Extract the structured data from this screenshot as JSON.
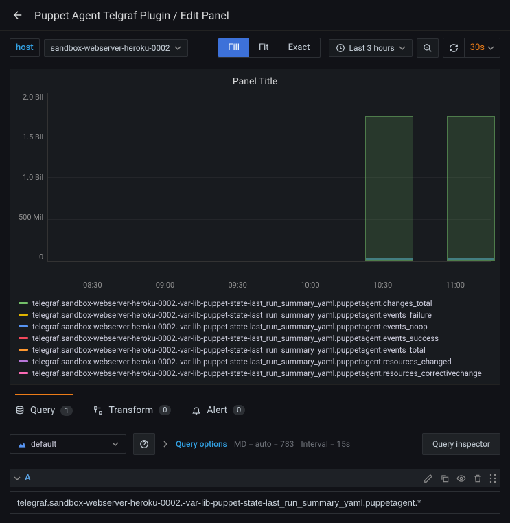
{
  "header": {
    "breadcrumb": "Puppet Agent Telgraf Plugin / Edit Panel"
  },
  "vars": {
    "host_label": "host",
    "host_value": "sandbox-webserver-heroku-0002"
  },
  "viewmode": {
    "fill": "Fill",
    "fit": "Fit",
    "exact": "Exact"
  },
  "timerange": {
    "label": "Last 3 hours",
    "refresh": "30s"
  },
  "chart": {
    "title": "Panel Title",
    "yticks": [
      "2.0 Bil",
      "1.5 Bil",
      "1.0 Bil",
      "500 Mil",
      "0"
    ],
    "xticks": [
      "08:30",
      "09:00",
      "09:30",
      "10:00",
      "10:30",
      "11:00"
    ]
  },
  "chart_data": {
    "type": "bar",
    "title": "Panel Title",
    "ylabel": "",
    "ylim": [
      0,
      2000000000
    ],
    "x": [
      "08:30",
      "09:00",
      "09:30",
      "10:00",
      "10:30",
      "11:00"
    ],
    "series": [
      {
        "name": "telegraf.sandbox-webserver-heroku-0002.-var-lib-puppet-state-last_run_summary_yaml.puppetagent.changes_total",
        "color": "#73bf69",
        "values": [
          null,
          null,
          null,
          null,
          1720000000,
          1720000000
        ]
      },
      {
        "name": "telegraf.sandbox-webserver-heroku-0002.-var-lib-puppet-state-last_run_summary_yaml.puppetagent.events_failure",
        "color": "#e0b400",
        "values": [
          null,
          null,
          null,
          null,
          0,
          0
        ]
      },
      {
        "name": "telegraf.sandbox-webserver-heroku-0002.-var-lib-puppet-state-last_run_summary_yaml.puppetagent.events_noop",
        "color": "#5794f2",
        "values": [
          null,
          null,
          null,
          null,
          0,
          0
        ]
      },
      {
        "name": "telegraf.sandbox-webserver-heroku-0002.-var-lib-puppet-state-last_run_summary_yaml.puppetagent.events_success",
        "color": "#f2495c",
        "values": [
          null,
          null,
          null,
          null,
          0,
          0
        ]
      },
      {
        "name": "telegraf.sandbox-webserver-heroku-0002.-var-lib-puppet-state-last_run_summary_yaml.puppetagent.events_total",
        "color": "#ff9830",
        "values": [
          null,
          null,
          null,
          null,
          0,
          0
        ]
      },
      {
        "name": "telegraf.sandbox-webserver-heroku-0002.-var-lib-puppet-state-last_run_summary_yaml.puppetagent.resources_changed",
        "color": "#b877d9",
        "values": [
          null,
          null,
          null,
          null,
          0,
          0
        ]
      },
      {
        "name": "telegraf.sandbox-webserver-heroku-0002.-var-lib-puppet-state-last_run_summary_yaml.puppetagent.resources_correctivechange",
        "color": "#fa6ab4",
        "values": [
          null,
          null,
          null,
          null,
          0,
          0
        ]
      }
    ]
  },
  "legend": [
    {
      "color": "#73bf69",
      "label": "telegraf.sandbox-webserver-heroku-0002.-var-lib-puppet-state-last_run_summary_yaml.puppetagent.changes_total"
    },
    {
      "color": "#e0b400",
      "label": "telegraf.sandbox-webserver-heroku-0002.-var-lib-puppet-state-last_run_summary_yaml.puppetagent.events_failure"
    },
    {
      "color": "#5794f2",
      "label": "telegraf.sandbox-webserver-heroku-0002.-var-lib-puppet-state-last_run_summary_yaml.puppetagent.events_noop"
    },
    {
      "color": "#f2495c",
      "label": "telegraf.sandbox-webserver-heroku-0002.-var-lib-puppet-state-last_run_summary_yaml.puppetagent.events_success"
    },
    {
      "color": "#ff9830",
      "label": "telegraf.sandbox-webserver-heroku-0002.-var-lib-puppet-state-last_run_summary_yaml.puppetagent.events_total"
    },
    {
      "color": "#b877d9",
      "label": "telegraf.sandbox-webserver-heroku-0002.-var-lib-puppet-state-last_run_summary_yaml.puppetagent.resources_changed"
    },
    {
      "color": "#fa6ab4",
      "label": "telegraf.sandbox-webserver-heroku-0002.-var-lib-puppet-state-last_run_summary_yaml.puppetagent.resources_correctivechange"
    }
  ],
  "tabs": {
    "query": "Query",
    "query_count": "1",
    "transform": "Transform",
    "transform_count": "0",
    "alert": "Alert",
    "alert_count": "0"
  },
  "queryrow": {
    "datasource": "default",
    "options_label": "Query options",
    "md": "MD = auto = 783",
    "interval": "Interval = 15s",
    "inspector": "Query inspector"
  },
  "query": {
    "name": "A",
    "expr": "telegraf.sandbox-webserver-heroku-0002.-var-lib-puppet-state-last_run_summary_yaml.puppetagent.*"
  }
}
